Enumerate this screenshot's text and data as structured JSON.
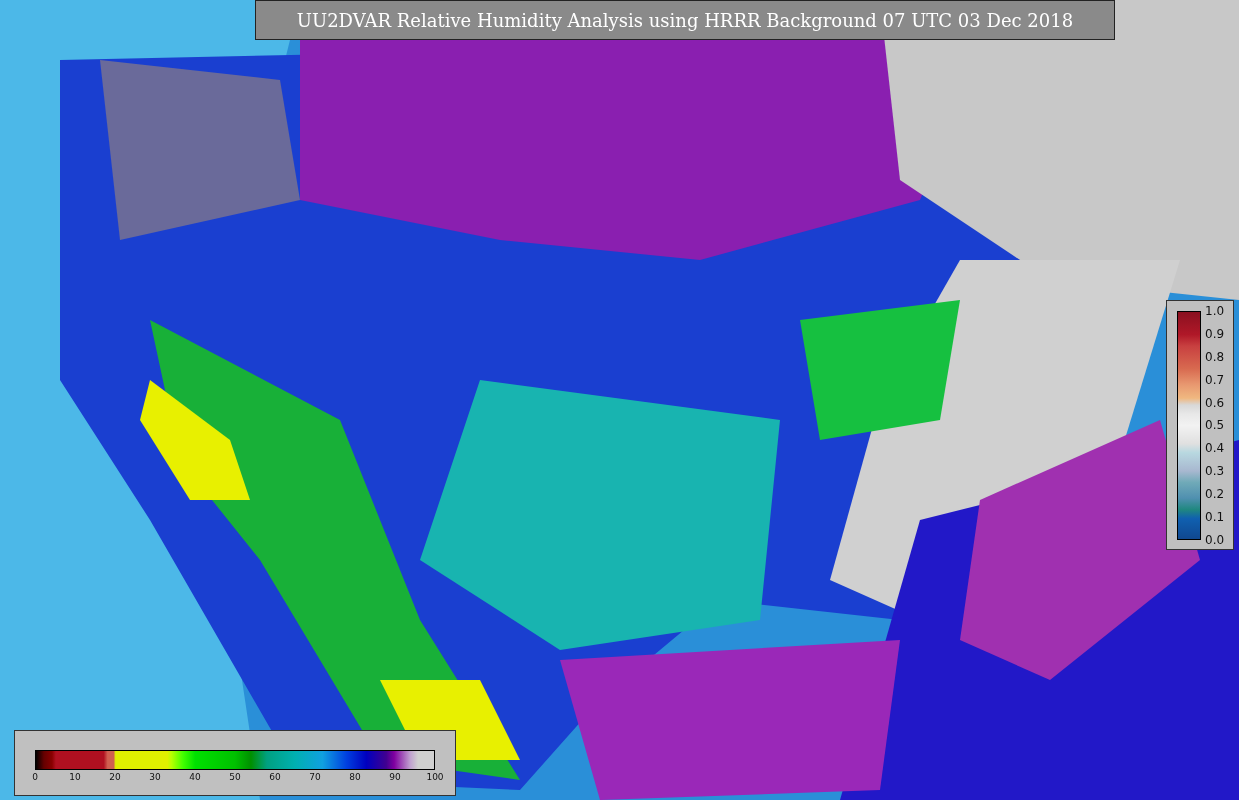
{
  "title": "UU2DVAR Relative Humidity Analysis using HRRR Background 07 UTC 03 Dec 2018",
  "humidity_legend": {
    "ticks": [
      "0",
      "10",
      "20",
      "30",
      "40",
      "50",
      "60",
      "70",
      "80",
      "90",
      "100"
    ]
  },
  "ratio_legend": {
    "ticks": [
      "1.0",
      "0.9",
      "0.8",
      "0.7",
      "0.6",
      "0.5",
      "0.4",
      "0.3",
      "0.2",
      "0.1",
      "0.0"
    ]
  }
}
